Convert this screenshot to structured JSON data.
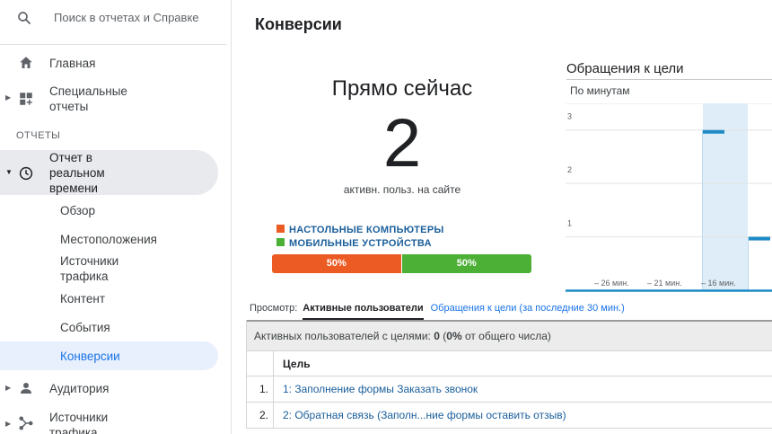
{
  "sidebar": {
    "search_placeholder": "Поиск в отчетах и Справке",
    "home": "Главная",
    "custom_reports": [
      "Специальные",
      "отчеты"
    ],
    "section_reports": "ОТЧЕТЫ",
    "realtime": [
      "Отчет в",
      "реальном",
      "времени"
    ],
    "realtime_sub": [
      "Обзор",
      "Местоположения",
      "Источники",
      "трафика",
      "Контент",
      "События",
      "Конверсии"
    ],
    "audience": "Аудитория",
    "acquisition": [
      "Источники",
      "трафика"
    ]
  },
  "main": {
    "title": "Конверсии",
    "now_title": "Прямо сейчас",
    "now_value": "2",
    "now_caption": "активн. польз. на сайте",
    "legend": [
      {
        "label": "НАСТОЛЬНЫЕ КОМПЬЮТЕРЫ",
        "color": "#eb5b23"
      },
      {
        "label": "МОБИЛЬНЫЕ УСТРОЙСТВА",
        "color": "#4caf36"
      }
    ],
    "split": [
      {
        "label": "50%",
        "share": 0.5,
        "color": "#eb5b23"
      },
      {
        "label": "50%",
        "share": 0.5,
        "color": "#4caf36"
      }
    ],
    "view_label": "Просмотр:",
    "view_active": "Активные пользователи",
    "view_link": "Обращения к цели (за последние 30 мин.)",
    "summary_prefix": "Активных пользователей с целями: ",
    "summary_value": "0",
    "summary_open": " (",
    "summary_pct": "0%",
    "summary_suffix": " от общего числа)",
    "table_header": "Цель",
    "rows": [
      {
        "num": "1.",
        "text": "1: Заполнение формы Заказать звонок"
      },
      {
        "num": "2.",
        "text": "2: Обратная связь (Заполн...ние формы оставить отзыв)"
      }
    ]
  },
  "chart_data": {
    "type": "bar",
    "title": "Обращения к цели",
    "subtitle": "По минутам",
    "yticks": [
      "1",
      "2",
      "3"
    ],
    "ylim": [
      0,
      3.5
    ],
    "xticks": [
      "– 26 мин.",
      "– 21 мин.",
      "– 16 мин."
    ],
    "bars": [
      {
        "category": "– 17 мин.",
        "value": 3
      },
      {
        "category": "– 16 мин.",
        "value": 1
      }
    ],
    "colors": {
      "bar": "#1c8bc6",
      "highlight": "#deedf7",
      "grid": "#e4e4e4"
    }
  }
}
